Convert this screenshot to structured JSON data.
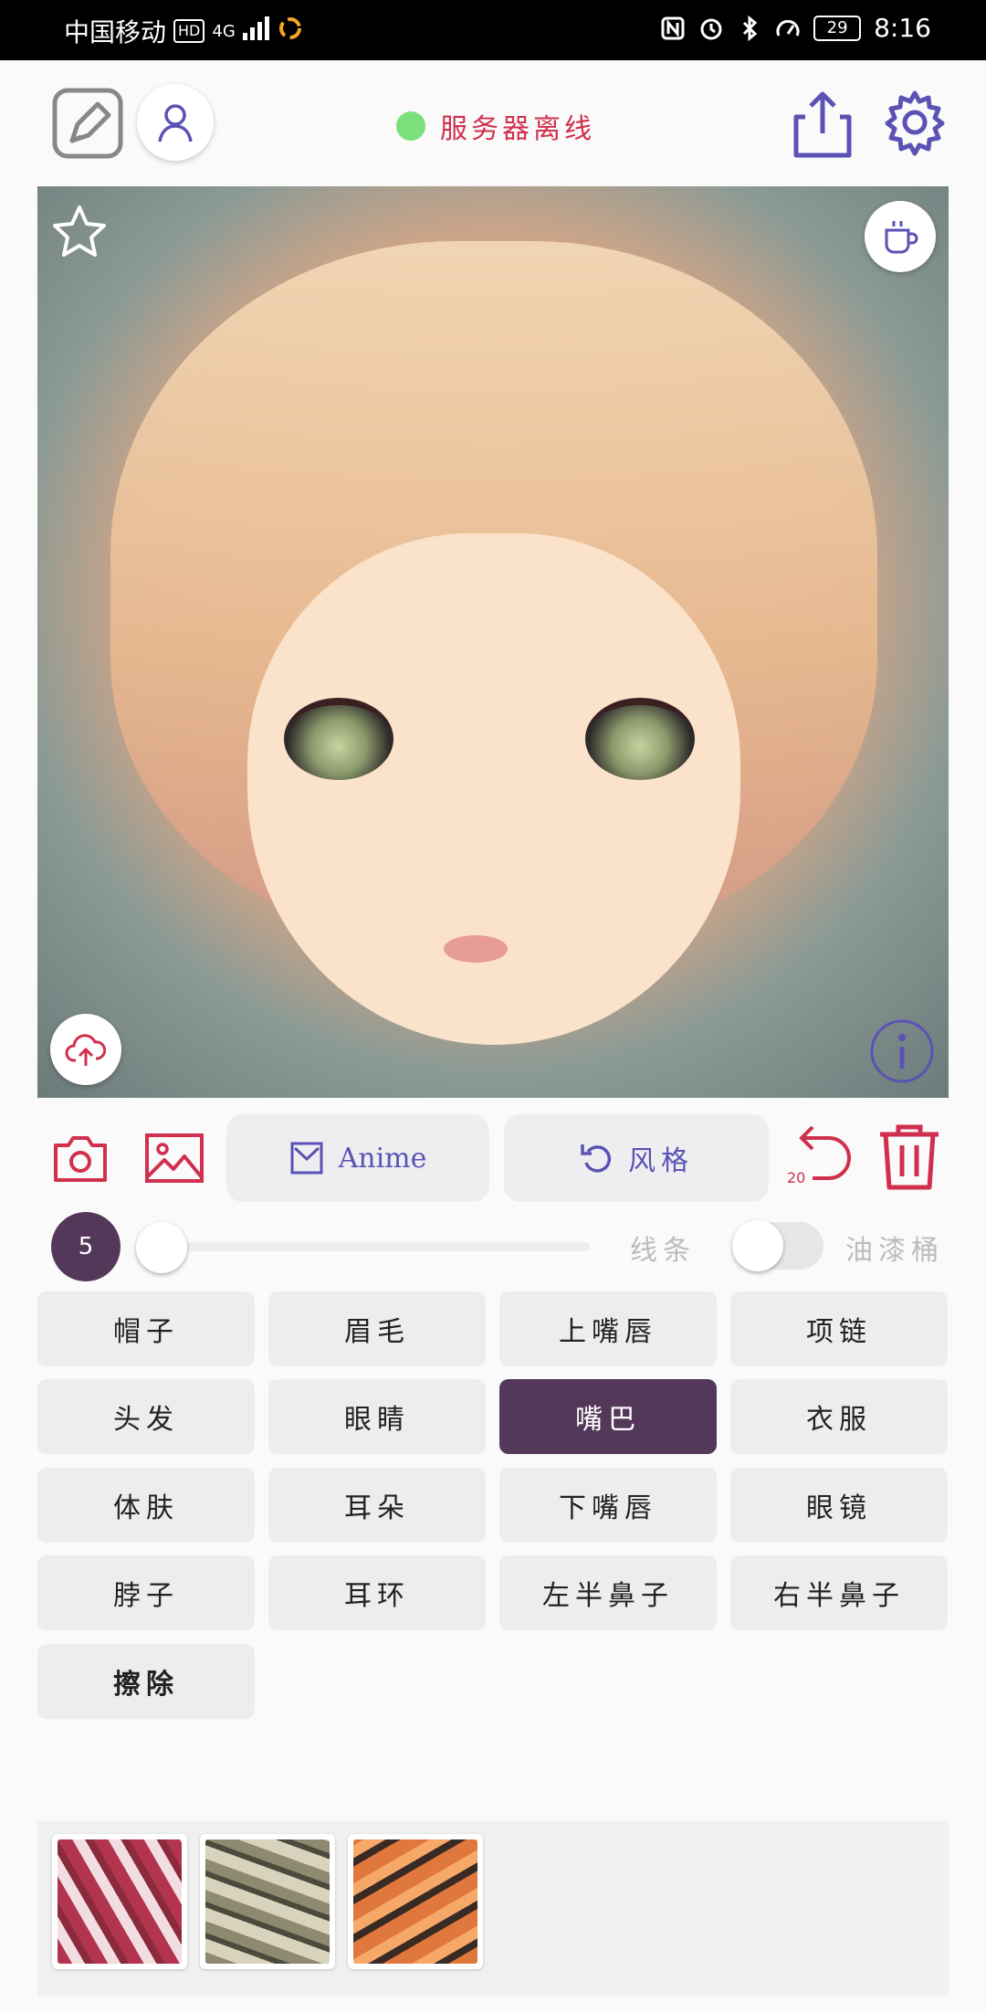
{
  "status_bar": {
    "carrier": "中国移动",
    "hd_badge": "HD",
    "network": "4G",
    "battery": "29",
    "time": "8:16"
  },
  "header": {
    "server_status": "服务器离线",
    "server_status_color": "#7be07b"
  },
  "toolbar": {
    "mode_label": "Anime",
    "style_label": "风格",
    "undo_count": "20"
  },
  "controls": {
    "brush_size": "5",
    "slider_value": 0,
    "line_label": "线条",
    "bucket_label": "油漆桶",
    "bucket_enabled": false
  },
  "parts": [
    {
      "label": "帽子",
      "active": false
    },
    {
      "label": "眉毛",
      "active": false
    },
    {
      "label": "上嘴唇",
      "active": false
    },
    {
      "label": "项链",
      "active": false
    },
    {
      "label": "头发",
      "active": false
    },
    {
      "label": "眼睛",
      "active": false
    },
    {
      "label": "嘴巴",
      "active": true
    },
    {
      "label": "衣服",
      "active": false
    },
    {
      "label": "体肤",
      "active": false
    },
    {
      "label": "耳朵",
      "active": false
    },
    {
      "label": "下嘴唇",
      "active": false
    },
    {
      "label": "眼镜",
      "active": false
    },
    {
      "label": "脖子",
      "active": false
    },
    {
      "label": "耳环",
      "active": false
    },
    {
      "label": "左半鼻子",
      "active": false
    },
    {
      "label": "右半鼻子",
      "active": false
    },
    {
      "label": "擦除",
      "active": false
    }
  ],
  "colors": {
    "accent_red": "#d0304d",
    "accent_purple": "#5a52b5",
    "active_part": "#54385a"
  }
}
